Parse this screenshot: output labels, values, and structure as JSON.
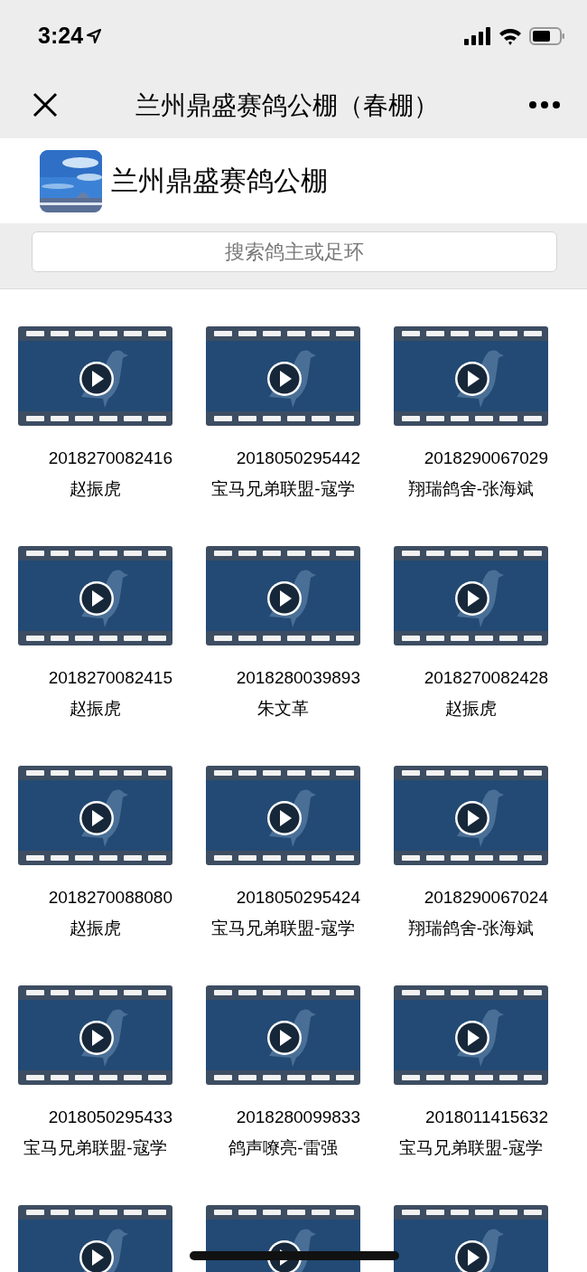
{
  "status_bar": {
    "time": "3:24"
  },
  "nav": {
    "title": "兰州鼎盛赛鸽公棚（春棚）"
  },
  "account": {
    "name": "兰州鼎盛赛鸽公棚"
  },
  "search": {
    "placeholder": "搜索鸽主或足环"
  },
  "videos": [
    {
      "ring": "2018270082416",
      "owner": "赵振虎"
    },
    {
      "ring": "2018050295442",
      "owner": "宝马兄弟联盟-寇学"
    },
    {
      "ring": "2018290067029",
      "owner": "翔瑞鸽舍-张海斌"
    },
    {
      "ring": "2018270082415",
      "owner": "赵振虎"
    },
    {
      "ring": "2018280039893",
      "owner": "朱文革"
    },
    {
      "ring": "2018270082428",
      "owner": "赵振虎"
    },
    {
      "ring": "2018270088080",
      "owner": "赵振虎"
    },
    {
      "ring": "2018050295424",
      "owner": "宝马兄弟联盟-寇学"
    },
    {
      "ring": "2018290067024",
      "owner": "翔瑞鸽舍-张海斌"
    },
    {
      "ring": "2018050295433",
      "owner": "宝马兄弟联盟-寇学"
    },
    {
      "ring": "2018280099833",
      "owner": "鸽声嘹亮-雷强"
    },
    {
      "ring": "2018011415632",
      "owner": "宝马兄弟联盟-寇学"
    },
    {
      "kind": "video"
    },
    {
      "kind": "video"
    },
    {
      "kind": "video"
    }
  ]
}
